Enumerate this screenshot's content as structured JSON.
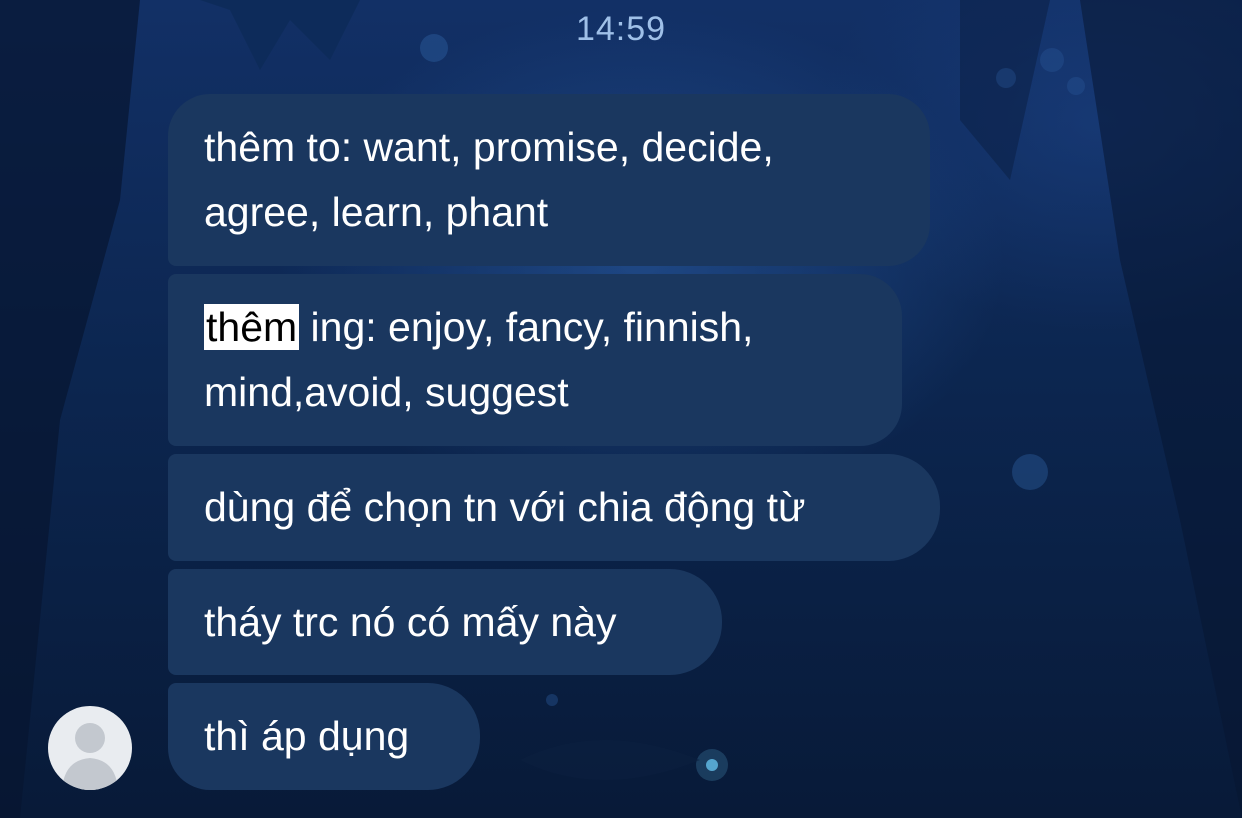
{
  "chat": {
    "timestamp": "14:59",
    "messages": [
      {
        "lines": [
          "thêm to: want, promise, decide,",
          "agree, learn, phant"
        ]
      },
      {
        "highlight": "thêm",
        "line1_rest": " ing: enjoy, fancy, finnish,",
        "line2": "mind,avoid, suggest"
      },
      {
        "text": "dùng để chọn tn với chia động từ"
      },
      {
        "text": "tháy trc nó có mấy này"
      },
      {
        "text": "thì áp dụng"
      }
    ],
    "sender_avatar_icon": "default-person-avatar-icon"
  },
  "colors": {
    "bubble": "#1a375f",
    "timestamp": "#9fc0e8",
    "highlight_bg": "#ffffff"
  }
}
